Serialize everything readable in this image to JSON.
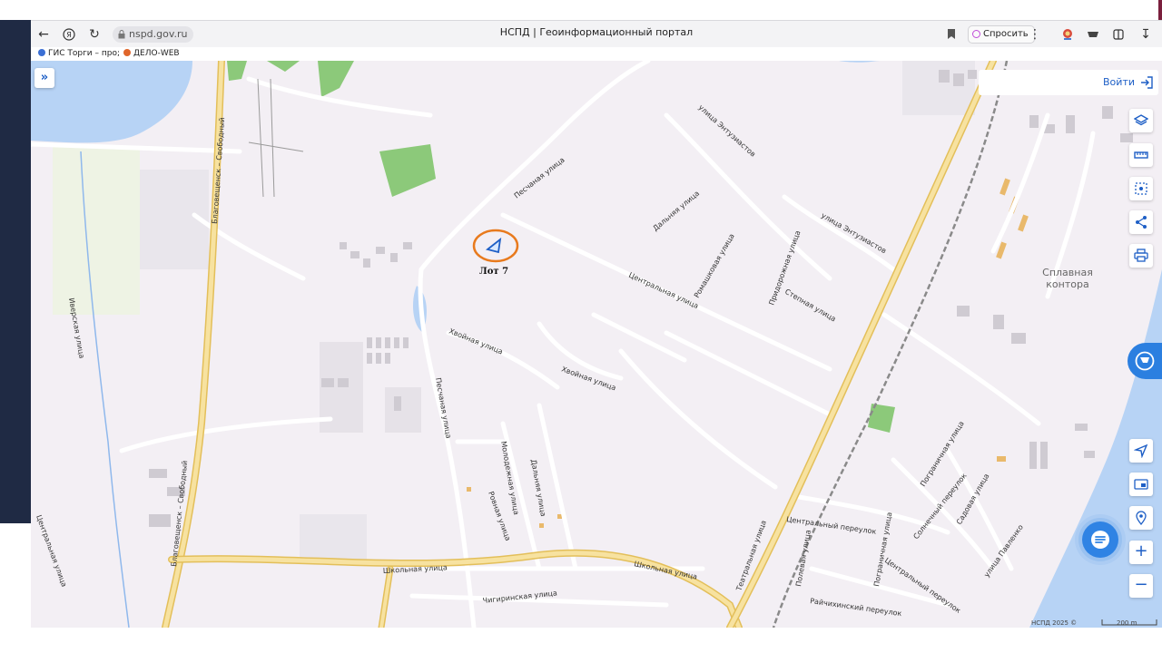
{
  "browser": {
    "url": "nspd.gov.ru",
    "title": "НСПД | Геоинформационный портал",
    "ask_button": "Спросить",
    "bookmarks": [
      {
        "label": "ГИС Торги – про;",
        "icon": "gis-icon"
      },
      {
        "label": "ДЕЛО-WEB",
        "icon": "delo-icon"
      }
    ]
  },
  "map": {
    "login_label": "Войти",
    "marker_label": "Лот 7",
    "place_labels": [
      "Сплавная",
      "контора"
    ],
    "streets": {
      "pesch_top": "Песчаная улица",
      "pesch_left": "Песчаная улица",
      "entuziastov_1": "улица Энтузиастов",
      "entuziastov_2": "улица Энтузиастов",
      "dalnyaya_1": "Дальняя улица",
      "dalnyaya_2": "Дальняя улица",
      "romashkovaya": "Ромашковая улица",
      "pridorozhnaya": "Придорожная улица",
      "stepnaya": "Степная улица",
      "centralnaya": "Центральная улица",
      "khvoinaya_1": "Хвойная улица",
      "khvoinaya_2": "Хвойная улица",
      "molodezhnaya": "Молодежная улица",
      "rovnaya": "Ровная улица",
      "shkolnaya_1": "Школьная улица",
      "shkolnaya_2": "Школьная улица",
      "chigirinskaya": "Чигиринская улица",
      "teatralnaya": "Театральная улица",
      "blag_svob_1": "Благовещенск – Свободный",
      "blag_svob_2": "Благовещенск – Свободный",
      "iverskaya": "Иверская улица",
      "centralnaya_west": "Центральная улица",
      "centralny_per_1": "Центральный переулок",
      "centralny_per_2": "Центральный переулок",
      "polevaya": "Полевая улица",
      "pogranichnaya_1": "Пограничная улица",
      "pogranichnaya_2": "Пограничная улица",
      "solnechny": "Солнечный переулок",
      "sadovaya": "Садовая улица",
      "pavlenko": "улица Павленко",
      "raichikhinsky": "Райчихинский переулок"
    },
    "copyright": "НСПД 2025 ©",
    "scale": "200 m"
  },
  "colors": {
    "map_bg": "#f3eff4",
    "water": "#b7d3f5",
    "road_major": "#f2d98a",
    "road_major_edge": "#e3bf5a",
    "green": "#8cc97a",
    "building": "#cfcbd2",
    "accent": "#1e5fc6",
    "marker_ring": "#e87a1d"
  }
}
